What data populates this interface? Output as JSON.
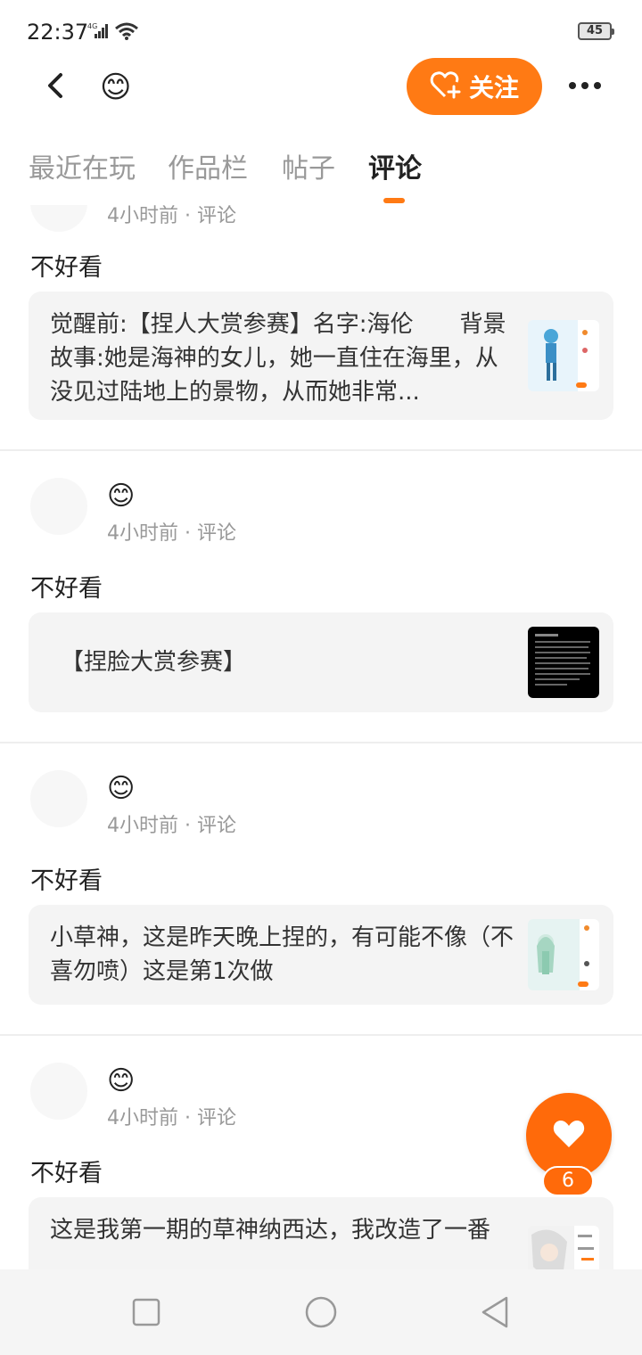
{
  "status_bar": {
    "time": "22:37",
    "network": "4G",
    "battery": "45"
  },
  "header": {
    "emoji": "😊",
    "follow_label": "关注"
  },
  "tabs": [
    {
      "label": "最近在玩"
    },
    {
      "label": "作品栏"
    },
    {
      "label": "帖子"
    },
    {
      "label": "评论",
      "active": true
    }
  ],
  "posts": [
    {
      "meta": "4小时前 · 评论",
      "comment": "不好看",
      "card_text": "觉醒前:【捏人大赏参赛】名字:海伦　　背景故事:她是海神的女儿，她一直住在海里，从没见过陆地上的景物，从而她非常..."
    },
    {
      "emoji": "😊",
      "meta": "4小时前 · 评论",
      "comment": "不好看",
      "card_text": "【捏脸大赏参赛】"
    },
    {
      "emoji": "😊",
      "meta": "4小时前 · 评论",
      "comment": "不好看",
      "card_text": "小草神，这是昨天晚上捏的，有可能不像（不喜勿喷）这是第1次做"
    },
    {
      "emoji": "😊",
      "meta": "4小时前 · 评论",
      "comment": "不好看",
      "card_text": "这是我第一期的草神纳西达，我改造了一番"
    }
  ],
  "like": {
    "count": "6"
  },
  "colors": {
    "accent": "#ff7a14",
    "like": "#ff6a0a",
    "card_bg": "#f4f4f4"
  },
  "icons": [
    "back-icon",
    "heart-plus-icon",
    "more-icon",
    "heart-icon",
    "home-square-icon",
    "home-circle-icon",
    "back-triangle-icon"
  ]
}
